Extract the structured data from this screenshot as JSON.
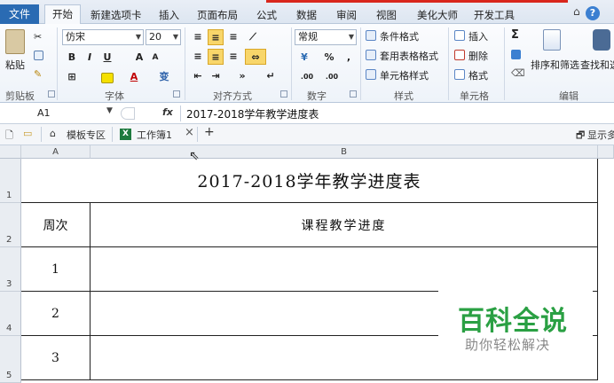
{
  "ribbon": {
    "file_tab": "文件",
    "tabs": [
      "开始",
      "新建选项卡",
      "插入",
      "页面布局",
      "公式",
      "数据",
      "审阅",
      "视图",
      "美化大师",
      "开发工具"
    ],
    "clipboard": {
      "paste_label": "粘贴",
      "group_label": "剪贴板"
    },
    "font": {
      "font_name": "仿宋",
      "font_size": "20",
      "bold": "B",
      "italic": "I",
      "underline": "U",
      "grow": "A",
      "shrink": "A",
      "font_color": "A",
      "phonetic": "变",
      "group_label": "字体"
    },
    "alignment": {
      "group_label": "对齐方式"
    },
    "number": {
      "format": "常规",
      "percent": "%",
      "comma": ",",
      "inc_decimal": ".00",
      "dec_decimal": ".00",
      "group_label": "数字"
    },
    "styles": {
      "conditional": "条件格式",
      "table_format": "套用表格格式",
      "cell_styles": "单元格样式",
      "group_label": "样式"
    },
    "cells": {
      "insert": "插入",
      "delete": "删除",
      "format": "格式",
      "group_label": "单元格"
    },
    "editing": {
      "sum": "Σ",
      "sort_filter": "排序和筛选",
      "find_select": "查找和选",
      "group_label": "编辑"
    },
    "help": "?"
  },
  "formula_bar": {
    "cell_ref": "A1",
    "fx": "fx",
    "content": "2017-2018学年教学进度表"
  },
  "doc_tabs": {
    "template": "模板专区",
    "workbook": "工作簿1",
    "add": "+",
    "show": "显示多"
  },
  "grid": {
    "columns": [
      "A",
      "B"
    ],
    "rows": [
      "1",
      "2",
      "3",
      "4",
      "5"
    ],
    "title": "2017-2018学年教学进度表",
    "header_week": "周次",
    "header_progress": "课程教学进度",
    "weeks": [
      "1",
      "2",
      "3"
    ]
  },
  "watermark": {
    "title": "百科全说",
    "subtitle": "助你轻松解决"
  }
}
